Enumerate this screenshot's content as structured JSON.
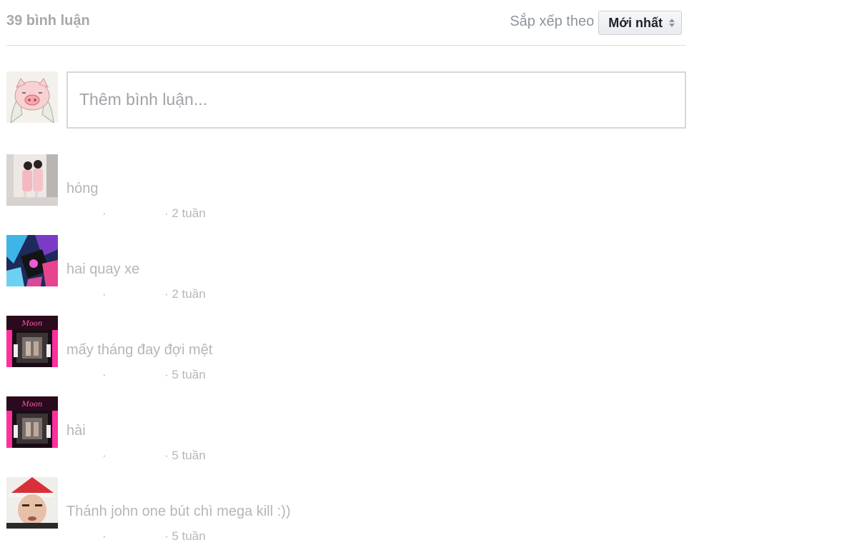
{
  "header": {
    "count_label": "39 bình luận",
    "sort_label": "Sắp xếp theo",
    "sort_value": "Mới nhất"
  },
  "composer": {
    "placeholder": "Thêm bình luận..."
  },
  "comments": [
    {
      "text": "hóng",
      "dot": "·",
      "time": "· 2 tuần"
    },
    {
      "text": "hai quay xe",
      "dot": "·",
      "time": "· 2 tuần"
    },
    {
      "text": "mấy tháng đay đợi mệt",
      "dot": "·",
      "time": "· 5 tuần"
    },
    {
      "text": "hài",
      "dot": "·",
      "time": "· 5 tuần"
    },
    {
      "text": "Thánh john one bút chì mega kill :))",
      "dot": "·",
      "time": "· 5 tuần"
    }
  ]
}
